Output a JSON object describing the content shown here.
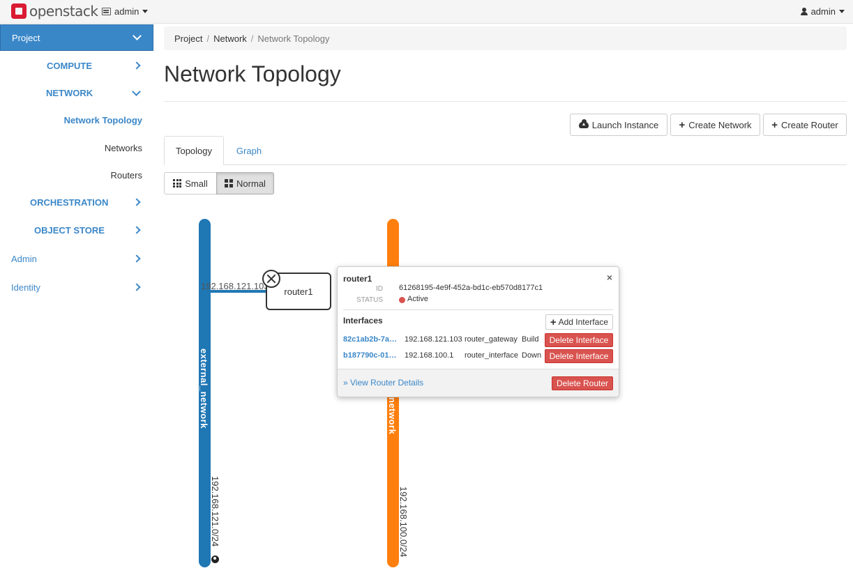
{
  "navbar": {
    "brand": "openstack",
    "project": "admin",
    "user": "admin"
  },
  "sidebar": {
    "project": "Project",
    "compute": "COMPUTE",
    "network": "NETWORK",
    "network_items": [
      "Network Topology",
      "Networks",
      "Routers"
    ],
    "orchestration": "ORCHESTRATION",
    "object_store": "OBJECT STORE",
    "admin": "Admin",
    "identity": "Identity"
  },
  "breadcrumb": [
    "Project",
    "Network",
    "Network Topology"
  ],
  "page_title": "Network Topology",
  "actions": {
    "launch_instance": "Launch Instance",
    "create_network": "Create Network",
    "create_router": "Create Router"
  },
  "tabs": [
    "Topology",
    "Graph"
  ],
  "size_toggle": {
    "small": "Small",
    "normal": "Normal",
    "selected": "Normal"
  },
  "topology": {
    "networks": [
      {
        "name": "external_network",
        "cidr": "192.168.121.0/24",
        "color": "#1f77b4"
      },
      {
        "name": "network",
        "cidr": "192.168.100.0/24",
        "color": "#ff7f0e"
      }
    ],
    "router": {
      "name": "router1"
    },
    "link_ip": "192.168.121.103"
  },
  "balloon": {
    "title": "router1",
    "id_label": "ID",
    "id": "61268195-4e9f-452a-bd1c-eb570d8177c1",
    "status_label": "STATUS",
    "status": "Active",
    "interfaces_title": "Interfaces",
    "add_interface": "Add Interface",
    "interfaces": [
      {
        "id": "82c1ab2b-7a…",
        "ip": "192.168.121.103",
        "type": "router_gateway",
        "state": "Build",
        "action": "Delete Interface"
      },
      {
        "id": "b187790c-01…",
        "ip": "192.168.100.1",
        "type": "router_interface",
        "state": "Down",
        "action": "Delete Interface"
      }
    ],
    "view_details": "» View Router Details",
    "delete_router": "Delete Router"
  }
}
